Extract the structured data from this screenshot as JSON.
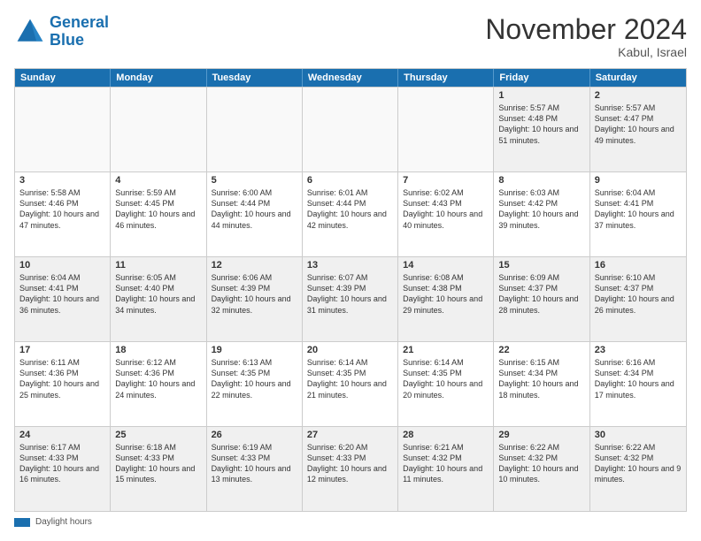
{
  "logo": {
    "line1": "General",
    "line2": "Blue"
  },
  "title": "November 2024",
  "location": "Kabul, Israel",
  "header_days": [
    "Sunday",
    "Monday",
    "Tuesday",
    "Wednesday",
    "Thursday",
    "Friday",
    "Saturday"
  ],
  "footer": {
    "bar_label": "Daylight hours"
  },
  "rows": [
    [
      {
        "day": "",
        "info": ""
      },
      {
        "day": "",
        "info": ""
      },
      {
        "day": "",
        "info": ""
      },
      {
        "day": "",
        "info": ""
      },
      {
        "day": "",
        "info": ""
      },
      {
        "day": "1",
        "info": "Sunrise: 5:57 AM\nSunset: 4:48 PM\nDaylight: 10 hours and 51 minutes."
      },
      {
        "day": "2",
        "info": "Sunrise: 5:57 AM\nSunset: 4:47 PM\nDaylight: 10 hours and 49 minutes."
      }
    ],
    [
      {
        "day": "3",
        "info": "Sunrise: 5:58 AM\nSunset: 4:46 PM\nDaylight: 10 hours and 47 minutes."
      },
      {
        "day": "4",
        "info": "Sunrise: 5:59 AM\nSunset: 4:45 PM\nDaylight: 10 hours and 46 minutes."
      },
      {
        "day": "5",
        "info": "Sunrise: 6:00 AM\nSunset: 4:44 PM\nDaylight: 10 hours and 44 minutes."
      },
      {
        "day": "6",
        "info": "Sunrise: 6:01 AM\nSunset: 4:44 PM\nDaylight: 10 hours and 42 minutes."
      },
      {
        "day": "7",
        "info": "Sunrise: 6:02 AM\nSunset: 4:43 PM\nDaylight: 10 hours and 40 minutes."
      },
      {
        "day": "8",
        "info": "Sunrise: 6:03 AM\nSunset: 4:42 PM\nDaylight: 10 hours and 39 minutes."
      },
      {
        "day": "9",
        "info": "Sunrise: 6:04 AM\nSunset: 4:41 PM\nDaylight: 10 hours and 37 minutes."
      }
    ],
    [
      {
        "day": "10",
        "info": "Sunrise: 6:04 AM\nSunset: 4:41 PM\nDaylight: 10 hours and 36 minutes."
      },
      {
        "day": "11",
        "info": "Sunrise: 6:05 AM\nSunset: 4:40 PM\nDaylight: 10 hours and 34 minutes."
      },
      {
        "day": "12",
        "info": "Sunrise: 6:06 AM\nSunset: 4:39 PM\nDaylight: 10 hours and 32 minutes."
      },
      {
        "day": "13",
        "info": "Sunrise: 6:07 AM\nSunset: 4:39 PM\nDaylight: 10 hours and 31 minutes."
      },
      {
        "day": "14",
        "info": "Sunrise: 6:08 AM\nSunset: 4:38 PM\nDaylight: 10 hours and 29 minutes."
      },
      {
        "day": "15",
        "info": "Sunrise: 6:09 AM\nSunset: 4:37 PM\nDaylight: 10 hours and 28 minutes."
      },
      {
        "day": "16",
        "info": "Sunrise: 6:10 AM\nSunset: 4:37 PM\nDaylight: 10 hours and 26 minutes."
      }
    ],
    [
      {
        "day": "17",
        "info": "Sunrise: 6:11 AM\nSunset: 4:36 PM\nDaylight: 10 hours and 25 minutes."
      },
      {
        "day": "18",
        "info": "Sunrise: 6:12 AM\nSunset: 4:36 PM\nDaylight: 10 hours and 24 minutes."
      },
      {
        "day": "19",
        "info": "Sunrise: 6:13 AM\nSunset: 4:35 PM\nDaylight: 10 hours and 22 minutes."
      },
      {
        "day": "20",
        "info": "Sunrise: 6:14 AM\nSunset: 4:35 PM\nDaylight: 10 hours and 21 minutes."
      },
      {
        "day": "21",
        "info": "Sunrise: 6:14 AM\nSunset: 4:35 PM\nDaylight: 10 hours and 20 minutes."
      },
      {
        "day": "22",
        "info": "Sunrise: 6:15 AM\nSunset: 4:34 PM\nDaylight: 10 hours and 18 minutes."
      },
      {
        "day": "23",
        "info": "Sunrise: 6:16 AM\nSunset: 4:34 PM\nDaylight: 10 hours and 17 minutes."
      }
    ],
    [
      {
        "day": "24",
        "info": "Sunrise: 6:17 AM\nSunset: 4:33 PM\nDaylight: 10 hours and 16 minutes."
      },
      {
        "day": "25",
        "info": "Sunrise: 6:18 AM\nSunset: 4:33 PM\nDaylight: 10 hours and 15 minutes."
      },
      {
        "day": "26",
        "info": "Sunrise: 6:19 AM\nSunset: 4:33 PM\nDaylight: 10 hours and 13 minutes."
      },
      {
        "day": "27",
        "info": "Sunrise: 6:20 AM\nSunset: 4:33 PM\nDaylight: 10 hours and 12 minutes."
      },
      {
        "day": "28",
        "info": "Sunrise: 6:21 AM\nSunset: 4:32 PM\nDaylight: 10 hours and 11 minutes."
      },
      {
        "day": "29",
        "info": "Sunrise: 6:22 AM\nSunset: 4:32 PM\nDaylight: 10 hours and 10 minutes."
      },
      {
        "day": "30",
        "info": "Sunrise: 6:22 AM\nSunset: 4:32 PM\nDaylight: 10 hours and 9 minutes."
      }
    ]
  ]
}
